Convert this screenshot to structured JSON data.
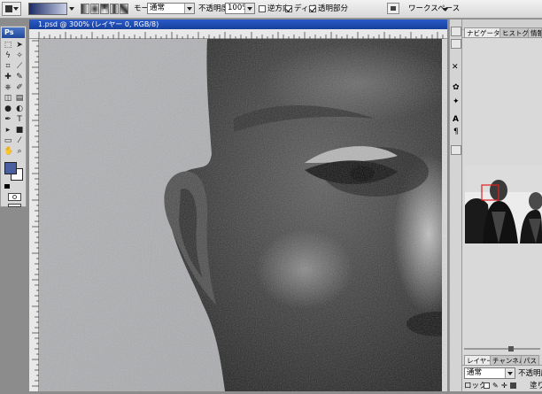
{
  "options_bar": {
    "mode_label": "モード:",
    "mode_value": "通常",
    "opacity_label": "不透明度:",
    "opacity_value": "100%",
    "reverse_label": "逆方向",
    "dither_label": "ディザ",
    "transparency_label": "透明部分",
    "workspace_label": "ワークスペース",
    "reverse_checked": false,
    "dither_checked": true,
    "transparency_checked": true
  },
  "toolbox": {
    "logo": "Ps",
    "foreground_color": "#4a5fa0",
    "background_color": "#ffffff"
  },
  "document": {
    "title": "1.psd @ 300% (レイヤー 0, RGB/8)"
  },
  "panels": {
    "navigator_tab": "ナビゲータ",
    "histogram_tab": "ヒストグラム",
    "info_tab": "情報",
    "layers_tab": "レイヤー",
    "channels_tab": "チャンネル",
    "paths_tab": "パス",
    "blend_mode": "通常",
    "opacity_label": "不透明度",
    "lock_label": "ロック:",
    "fill_label": "塗り"
  }
}
